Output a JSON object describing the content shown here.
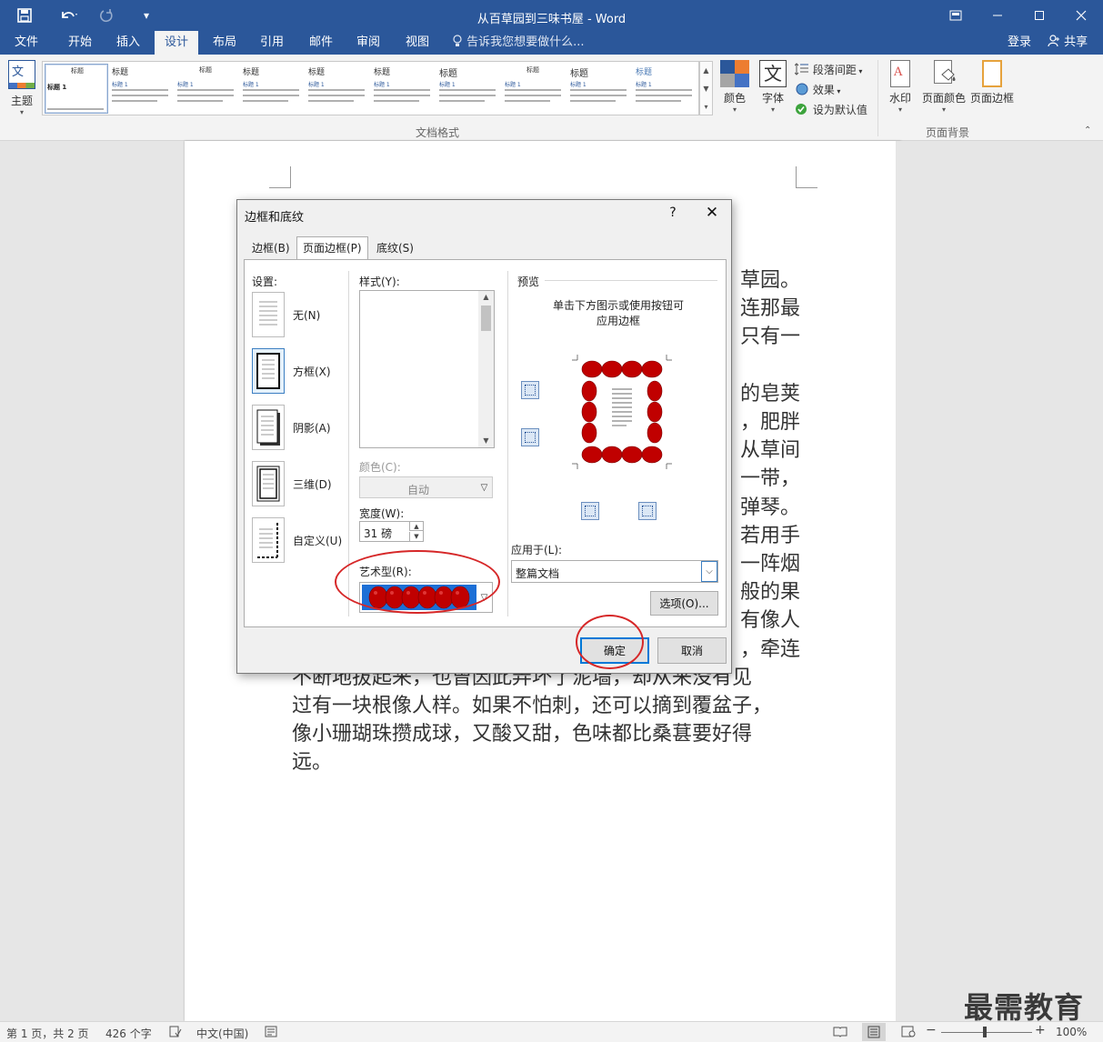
{
  "window": {
    "title": "从百草园到三味书屋 - Word",
    "qa_more": "▾"
  },
  "tabs": [
    {
      "label": "文件"
    },
    {
      "label": "开始"
    },
    {
      "label": "插入"
    },
    {
      "label": "设计",
      "active": true
    },
    {
      "label": "布局"
    },
    {
      "label": "引用"
    },
    {
      "label": "邮件"
    },
    {
      "label": "审阅"
    },
    {
      "label": "视图"
    }
  ],
  "tell_me": "告诉我您想要做什么...",
  "account": {
    "login": "登录",
    "share": "共享"
  },
  "ribbon": {
    "theme_button": "主题",
    "group_document_format": "文档格式",
    "gallery": [
      {
        "title": "标题",
        "heading": "标题 1"
      },
      {
        "title": "标题",
        "heading": "标题 1"
      },
      {
        "title": "标题",
        "heading": "标题 1"
      },
      {
        "title": "标题",
        "heading": "标题 1"
      },
      {
        "title": "标题",
        "heading": "标题 1"
      },
      {
        "title": "标题",
        "heading": "标题 1"
      },
      {
        "title": "标题",
        "heading": "标题 1"
      },
      {
        "title": "标题",
        "heading": "标题 1"
      },
      {
        "title": "标题",
        "heading": "标题 1"
      },
      {
        "title": "标题",
        "heading": "标题 1"
      }
    ],
    "colors_button": "颜色",
    "fonts_button": "字体",
    "fonts_glyph": "文",
    "paragraph_spacing": "段落间距",
    "effects": "效果",
    "set_default": "设为默认值",
    "watermark_button": "水印",
    "page_color_button": "页面颜色",
    "page_borders_button": "页面边框",
    "group_page_background": "页面背景"
  },
  "document": {
    "lines": [
      {
        "text": "草园。",
        "align": "right"
      },
      {
        "text": "连那最",
        "align": "right"
      },
      {
        "text": "只有一",
        "align": "right"
      },
      {
        "text": "",
        "align": "right"
      },
      {
        "text": "的皂荚",
        "align": "right"
      },
      {
        "text": "，肥胖",
        "align": "right"
      },
      {
        "text": "从草间",
        "align": "right"
      },
      {
        "text": "一带，",
        "align": "right"
      },
      {
        "text": "弹琴。",
        "align": "right"
      },
      {
        "text": "若用手",
        "align": "right"
      },
      {
        "text": "一阵烟",
        "align": "right"
      },
      {
        "text": "般的果",
        "align": "right"
      },
      {
        "text": "有像人",
        "align": "right"
      },
      {
        "text": "，牵连",
        "align": "right"
      },
      {
        "text": "不断地拔起来，也曾因此弄坏了泥墙，却从来没有见",
        "align": "left"
      },
      {
        "text": "过有一块根像人样。如果不怕刺，还可以摘到覆盆子，",
        "align": "left"
      },
      {
        "text": "像小珊瑚珠攒成球，又酸又甜，色味都比桑葚要好得",
        "align": "left"
      },
      {
        "text": "远。",
        "align": "left"
      }
    ]
  },
  "dialog": {
    "title": "边框和底纹",
    "help": "?",
    "tabs": [
      {
        "label": "边框(B)"
      },
      {
        "label": "页面边框(P)",
        "active": true
      },
      {
        "label": "底纹(S)"
      }
    ],
    "settings_label": "设置:",
    "settings": [
      {
        "label": "无(N)"
      },
      {
        "label": "方框(X)",
        "selected": true
      },
      {
        "label": "阴影(A)"
      },
      {
        "label": "三维(D)"
      },
      {
        "label": "自定义(U)"
      }
    ],
    "style_label": "样式(Y):",
    "color_label": "颜色(C):",
    "color_value": "自动",
    "width_label": "宽度(W):",
    "width_value": "31 磅",
    "art_label": "艺术型(R):",
    "preview_label": "预览",
    "preview_hint_1": "单击下方图示或使用按钮可",
    "preview_hint_2": "应用边框",
    "apply_label": "应用于(L):",
    "apply_value": "整篇文档",
    "options_button": "选项(O)...",
    "ok_button": "确定",
    "cancel_button": "取消",
    "border_color": "#c00000"
  },
  "status": {
    "page": "第 1 页，共 2 页",
    "words": "426 个字",
    "language": "中文(中国)",
    "zoom": "100%"
  },
  "watermark_text": "最需教育"
}
